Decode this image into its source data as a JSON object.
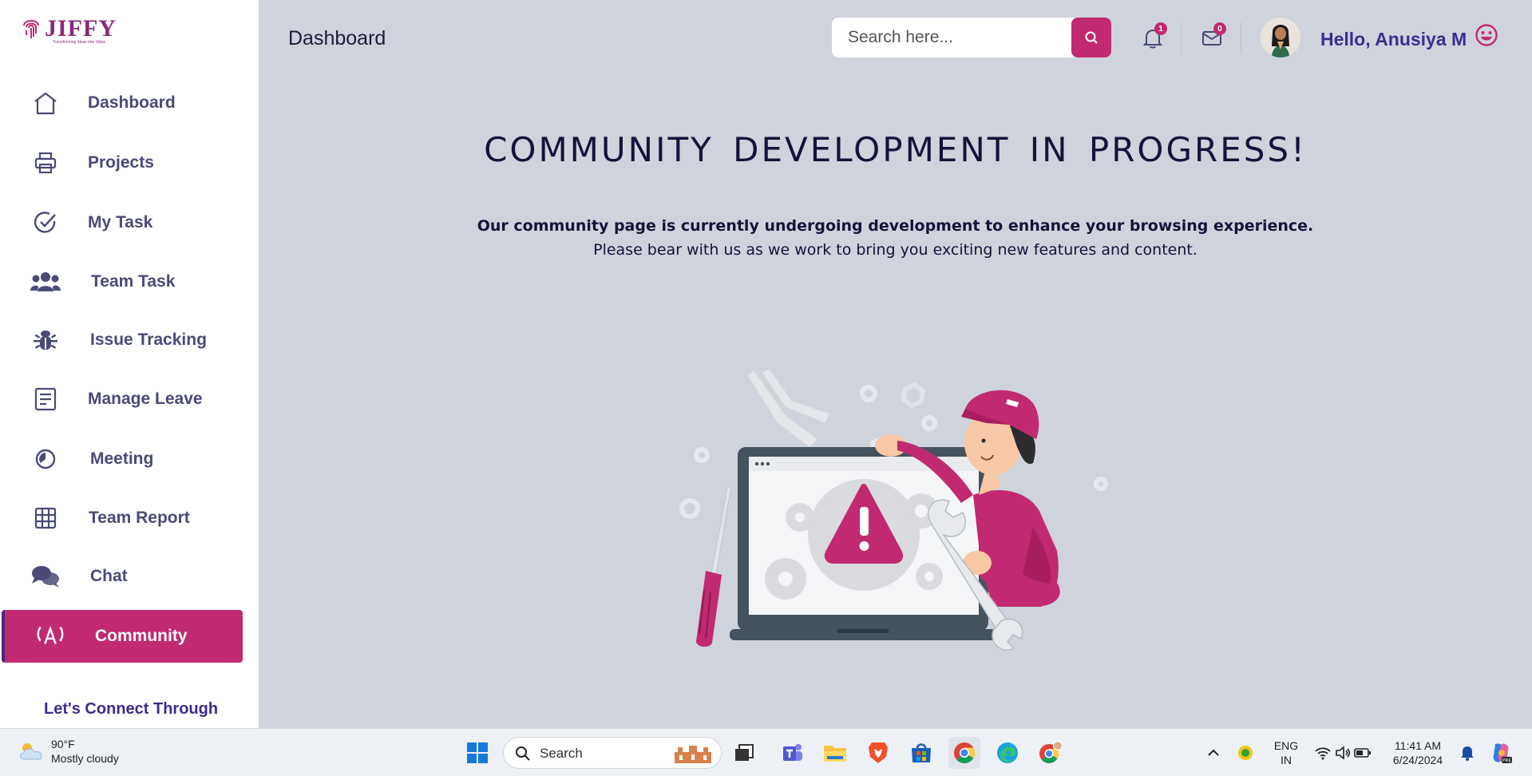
{
  "app": {
    "logo_text": "JIFFY",
    "logo_tagline": "Transforming Ideas into Value"
  },
  "sidebar": {
    "items": [
      {
        "label": "Dashboard",
        "icon": "home-icon"
      },
      {
        "label": "Projects",
        "icon": "printer-icon"
      },
      {
        "label": "My Task",
        "icon": "check-circle-icon"
      },
      {
        "label": "Team Task",
        "icon": "users-icon"
      },
      {
        "label": "Issue Tracking",
        "icon": "bug-icon"
      },
      {
        "label": "Manage Leave",
        "icon": "document-icon"
      },
      {
        "label": "Meeting",
        "icon": "clock-icon"
      },
      {
        "label": "Team Report",
        "icon": "grid-icon"
      },
      {
        "label": "Chat",
        "icon": "chat-icon"
      },
      {
        "label": "Community",
        "icon": "broadcast-icon",
        "active": true
      }
    ],
    "connect_label": "Let's Connect Through"
  },
  "header": {
    "title": "Dashboard",
    "search_placeholder": "Search here...",
    "notifications_count": "1",
    "messages_count": "0",
    "greeting": "Hello, Anusiya M"
  },
  "content": {
    "headline": "COMMUNITY DEVELOPMENT IN PROGRESS!",
    "line1": "Our community page is currently undergoing development to enhance your browsing experience.",
    "line2": "Please bear with us as we work to bring you exciting new features and content."
  },
  "taskbar": {
    "weather_temp": "90°F",
    "weather_desc": "Mostly cloudy",
    "search_label": "Search",
    "lang_line1": "ENG",
    "lang_line2": "IN",
    "time": "11:41 AM",
    "date": "6/24/2024"
  },
  "colors": {
    "accent": "#c12a70",
    "brand_text": "#3b2d8f",
    "background": "#cfd4dc"
  }
}
